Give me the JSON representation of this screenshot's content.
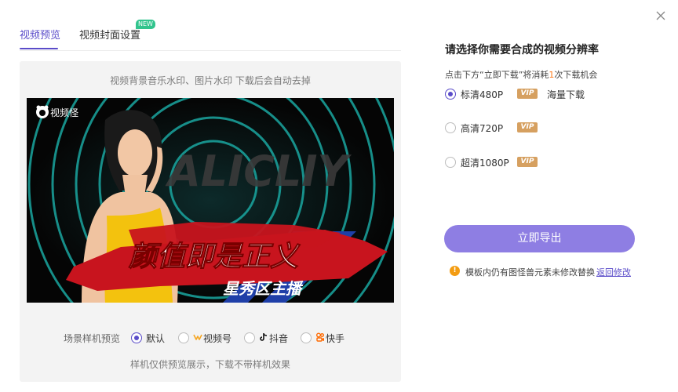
{
  "tabs": {
    "preview_label": "视频预览",
    "cover_label": "视频封面设置",
    "new_badge": "NEW"
  },
  "preview_panel": {
    "top_hint": "视频背景音乐水印、图片水印 下载后会自动去掉",
    "watermark_logo_text": "视频怪",
    "bg_text": "ALICLIY",
    "headline": "颜值即是正义",
    "subheadline": "星秀区主播",
    "scene_label": "场景样机预览",
    "scene_options": [
      {
        "label": "默认",
        "selected": true
      },
      {
        "label": "视频号",
        "selected": false,
        "icon": "wechat-channels-icon"
      },
      {
        "label": "抖音",
        "selected": false,
        "icon": "douyin-icon"
      },
      {
        "label": "快手",
        "selected": false,
        "icon": "kuaishou-icon"
      }
    ],
    "bottom_hint": "样机仅供预览展示，下载不带样机效果"
  },
  "export_panel": {
    "title": "请选择你需要合成的视频分辨率",
    "subtitle_before": "点击下方“立即下载”将消耗",
    "subtitle_count": "1",
    "subtitle_after": "次下载机会",
    "resolutions": [
      {
        "label": "标清480P",
        "vip": "VIP",
        "extra": "海量下载",
        "selected": true
      },
      {
        "label": "高清720P",
        "vip": "VIP",
        "selected": false
      },
      {
        "label": "超清1080P",
        "vip": "VIP",
        "selected": false
      }
    ],
    "export_button": "立即导出",
    "warning_text": "模板内仍有图怪兽元素未修改替换",
    "warning_link": "返回修改"
  },
  "colors": {
    "accent": "#5a4cc9",
    "button": "#8e7ee3",
    "vip": "#d6a060",
    "new_badge": "#31c48d",
    "warning": "#f39c12",
    "count_highlight": "#ff7a1a",
    "preview_red": "#c8141e",
    "preview_blue": "#1f3fa8",
    "ring_teal": "#1aa6a0"
  }
}
